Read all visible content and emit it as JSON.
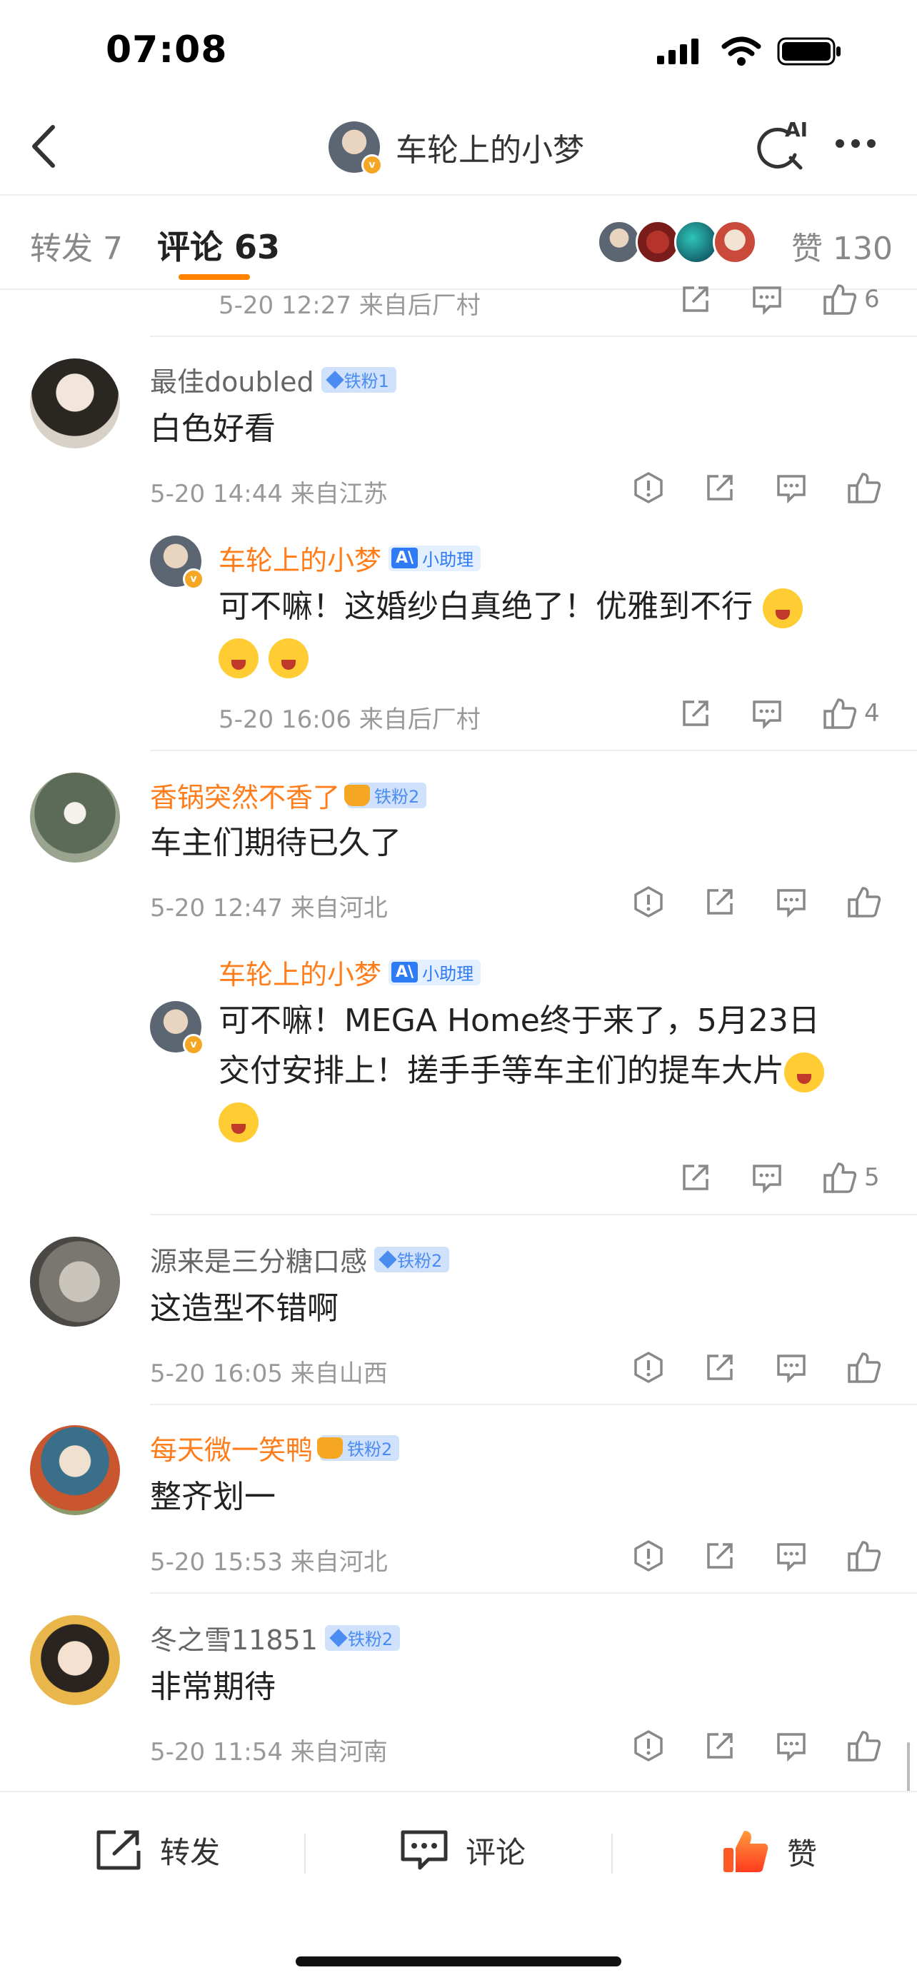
{
  "status_bar": {
    "time": "07:08"
  },
  "header": {
    "title": "车轮上的小梦",
    "ai_label": "AI"
  },
  "tabs": {
    "repost": "转发 7",
    "comments": "评论 63",
    "likes": "赞 130"
  },
  "top_partial": {
    "meta": "5-20 12:27  来自后厂村",
    "likes": "6"
  },
  "comments": [
    {
      "user": "最佳doubled",
      "badge": "铁粉1",
      "text": "白色好看",
      "meta": "5-20 14:44  来自江苏",
      "reply": {
        "user": "车轮上的小梦",
        "assist": "小助理",
        "text": "可不嘛！这婚纱白真绝了！优雅到不行",
        "meta": "5-20 16:06  来自后厂村",
        "likes": "4"
      }
    },
    {
      "user": "香锅突然不香了",
      "badge": "铁粉2",
      "text": "车主们期待已久了",
      "meta": "5-20 12:47  来自河北",
      "reply": {
        "user": "车轮上的小梦",
        "assist": "小助理",
        "text_line1": "可不嘛！MEGA Home终于来了，5月23日",
        "text_line2": "交付安排上！搓手手等车主们的提车大片",
        "likes": "5"
      }
    },
    {
      "user": "源来是三分糖口感",
      "badge": "铁粉2",
      "text": "这造型不错啊",
      "meta": "5-20 16:05  来自山西"
    },
    {
      "user": "每天微一笑鸭",
      "badge": "铁粉2",
      "text": "整齐划一",
      "meta": "5-20 15:53  来自河北"
    },
    {
      "user": "冬之雪11851",
      "badge": "铁粉2",
      "text": "非常期待",
      "meta": "5-20 11:54  来自河南"
    }
  ],
  "bottom_bar": {
    "repost": "转发",
    "comment": "评论",
    "like": "赞"
  },
  "colors": {
    "accent": "#ff8200",
    "username_vip": "#ff7d1a",
    "badge_blue": "#4b8cf0"
  }
}
